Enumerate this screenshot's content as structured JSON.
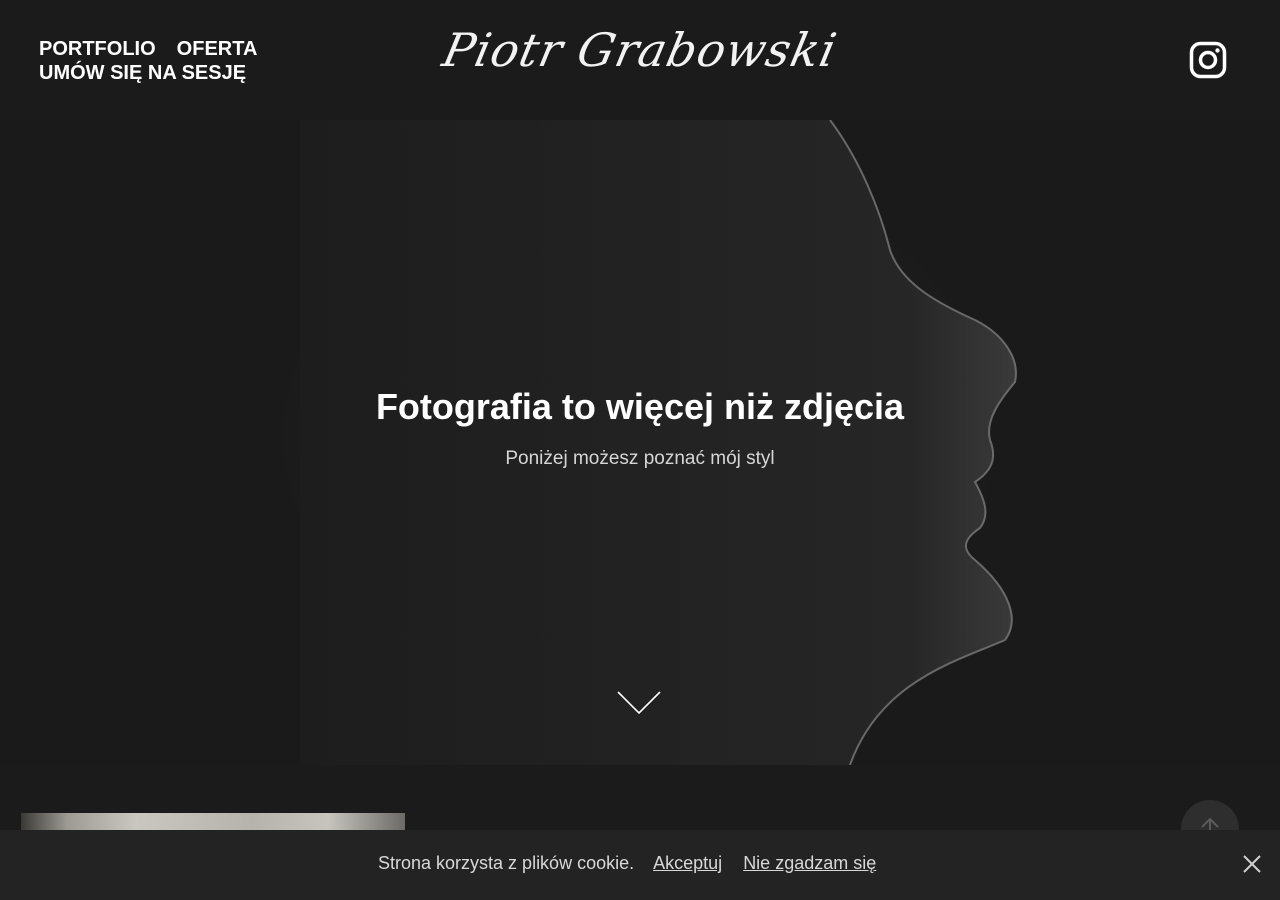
{
  "header": {
    "nav": [
      {
        "label": "PORTFOLIO"
      },
      {
        "label": "OFERTA"
      },
      {
        "label": "UMÓW SIĘ NA SESJĘ"
      }
    ],
    "logo_text": "Piotr Grabowski",
    "social_icon": "instagram-icon"
  },
  "hero": {
    "title": "Fotografia to więcej niż zdjęcia",
    "subtitle": "Poniżej możesz poznać mój styl",
    "scroll_icon": "chevron-down-icon"
  },
  "back_to_top": {
    "icon": "arrow-up-icon"
  },
  "cookie_bar": {
    "message": "Strona korzysta z plików cookie.",
    "accept_label": "Akceptuj",
    "decline_label": "Nie zgadzam się",
    "close_icon": "close-icon"
  },
  "colors": {
    "background": "#1b1b1b",
    "text": "#ffffff",
    "cookie_bar": "#232323"
  }
}
